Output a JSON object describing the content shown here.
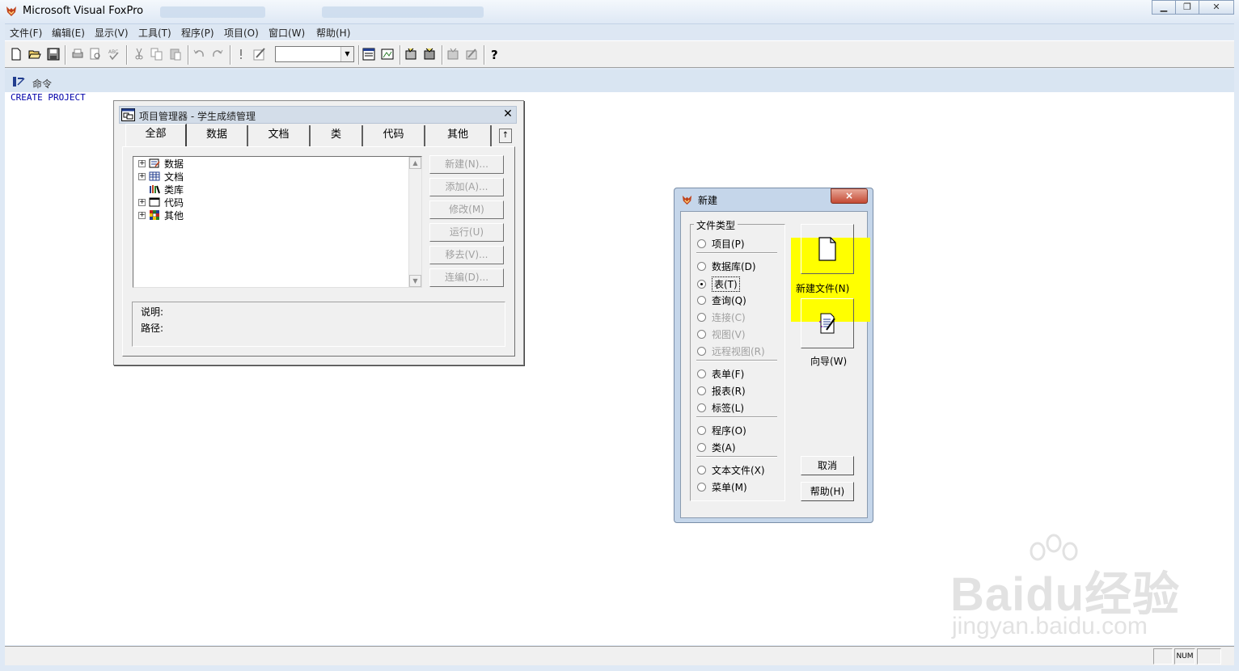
{
  "window": {
    "title": "Microsoft Visual FoxPro"
  },
  "menu": {
    "items": [
      "文件(F)",
      "编辑(E)",
      "显示(V)",
      "工具(T)",
      "程序(P)",
      "项目(O)",
      "窗口(W)",
      "帮助(H)"
    ]
  },
  "command_window": {
    "title": "命令",
    "text": "CREATE PROJECT"
  },
  "project_manager": {
    "title": "项目管理器 - 学生成绩管理",
    "tabs": [
      "全部",
      "数据",
      "文档",
      "类",
      "代码",
      "其他"
    ],
    "active_tab": "全部",
    "tree": [
      "数据",
      "文档",
      "类库",
      "代码",
      "其他"
    ],
    "buttons": [
      "新建(N)...",
      "添加(A)...",
      "修改(M)",
      "运行(U)",
      "移去(V)...",
      "连编(D)..."
    ],
    "desc_label": "说明:",
    "path_label": "路径:"
  },
  "new_dialog": {
    "title": "新建",
    "close": "×",
    "group_label": "文件类型",
    "options": [
      "项目(P)",
      "数据库(D)",
      "表(T)",
      "查询(Q)",
      "连接(C)",
      "视图(V)",
      "远程视图(R)",
      "表单(F)",
      "报表(R)",
      "标签(L)",
      "程序(O)",
      "类(A)",
      "文本文件(X)",
      "菜单(M)"
    ],
    "selected": "表(T)",
    "new_file_label": "新建文件(N)",
    "wizard_label": "向导(W)",
    "cancel_label": "取消",
    "help_label": "帮助(H)"
  },
  "status": {
    "num": "NUM"
  },
  "watermark": {
    "brand": "Baidu经验",
    "url": "jingyan.baidu.com"
  },
  "colors": {
    "highlight": "#ffff00",
    "command_text": "#0000aa",
    "dialog_frame": "#c5d6ea"
  }
}
